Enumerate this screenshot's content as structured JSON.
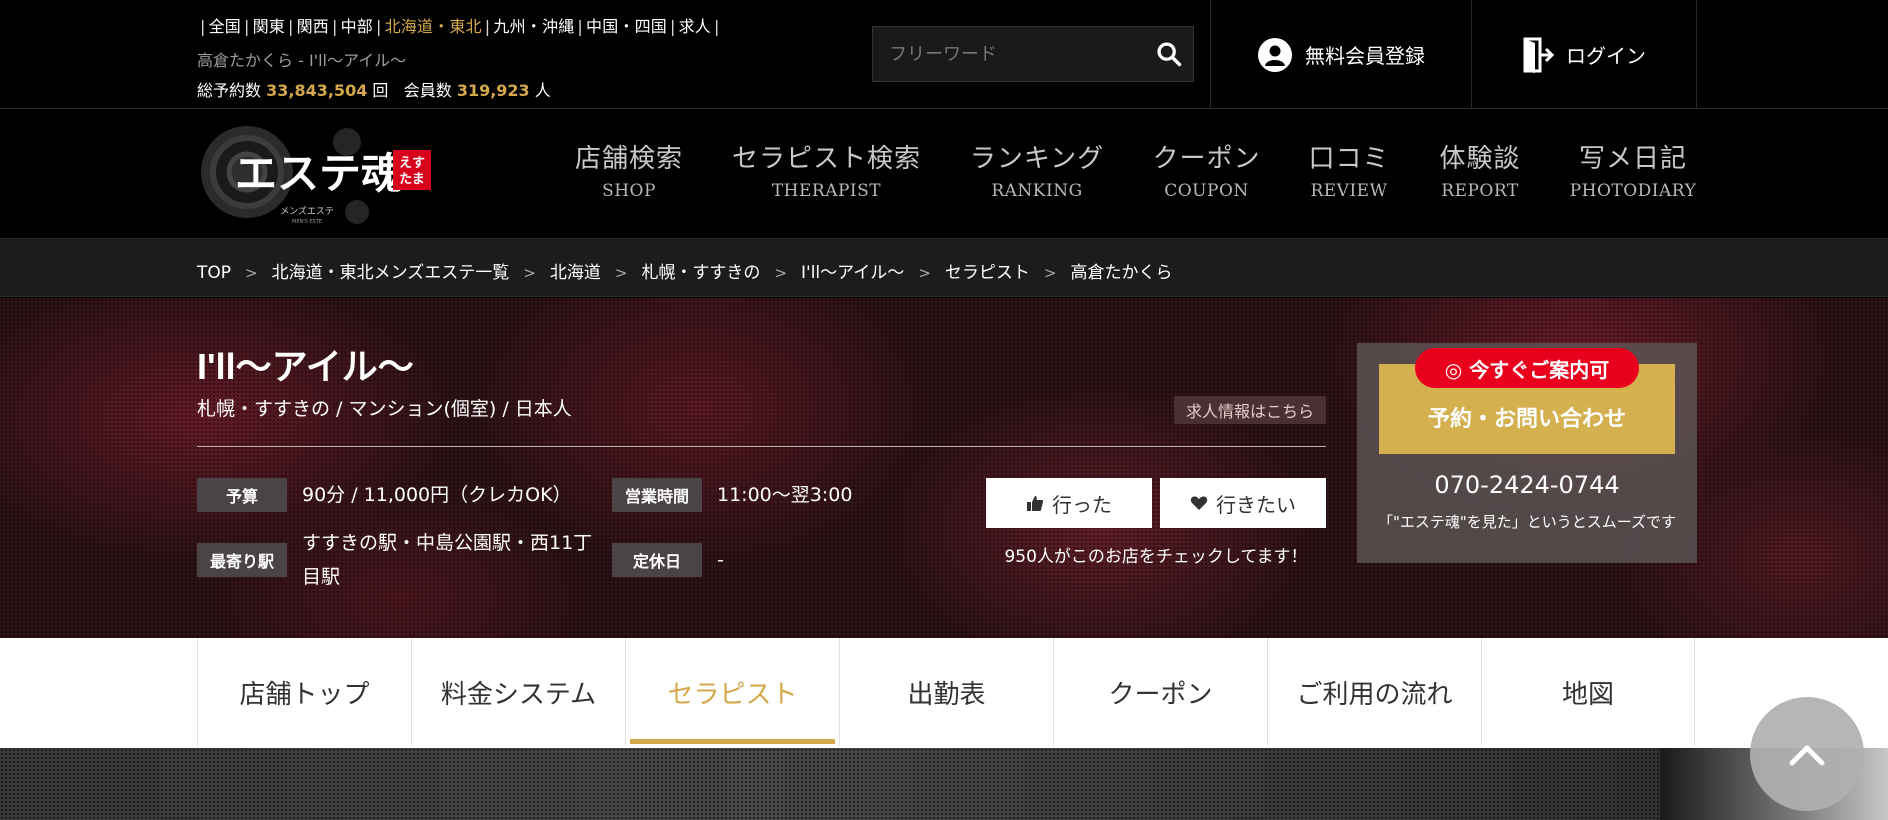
{
  "top": {
    "regions": [
      "全国",
      "関東",
      "関西",
      "中部",
      "北海道・東北",
      "九州・沖縄",
      "中国・四国",
      "求人"
    ],
    "active_region": "北海道・東北",
    "page_subtitle": "高倉たかくら - I'll〜アイル〜",
    "stats": {
      "bookings_label": "総予約数",
      "bookings": "33,843,504",
      "bookings_unit": "回",
      "members_label": "会員数",
      "members": "319,923",
      "members_unit": "人"
    },
    "search_placeholder": "フリーワード",
    "register_label": "無料会員登録",
    "login_label": "ログイン"
  },
  "logo": {
    "text": "エステ魂",
    "badge": "えすたま",
    "tagline": "メンズエステ",
    "tagline_en": "MEN'S ESTE"
  },
  "nav": [
    {
      "jp": "店舗検索",
      "en": "SHOP"
    },
    {
      "jp": "セラピスト検索",
      "en": "THERAPIST"
    },
    {
      "jp": "ランキング",
      "en": "RANKING"
    },
    {
      "jp": "クーポン",
      "en": "COUPON"
    },
    {
      "jp": "口コミ",
      "en": "REVIEW"
    },
    {
      "jp": "体験談",
      "en": "REPORT"
    },
    {
      "jp": "写メ日記",
      "en": "PHOTODIARY"
    }
  ],
  "breadcrumb": [
    "TOP",
    "北海道・東北メンズエステ一覧",
    "北海道",
    "札幌・すすきの",
    "I'll〜アイル〜",
    "セラピスト",
    "高倉たかくら"
  ],
  "shop": {
    "name": "I'll〜アイル〜",
    "subtitle": "札幌・すすきの / マンション(個室) / 日本人",
    "recruit": "求人情報はこちら",
    "budget_label": "予算",
    "budget": "90分 / 11,000円（クレカOK）",
    "hours_label": "営業時間",
    "hours": "11:00〜翌3:00",
    "station_label": "最寄り駅",
    "station": "すすきの駅・中島公園駅・西11丁目駅",
    "holiday_label": "定休日",
    "holiday": "-",
    "went": "行った",
    "want": "行きたい",
    "check_count": "950人がこのお店をチェックしてます！"
  },
  "contact": {
    "badge": "◎ 今すぐご案内可",
    "button": "予約・お問い合わせ",
    "phone": "070-2424-0744",
    "note": "「\"エステ魂\"を見た」というとスムーズです"
  },
  "tabs": [
    "店舗トップ",
    "料金システム",
    "セラピスト",
    "出勤表",
    "クーポン",
    "ご利用の流れ",
    "地図"
  ],
  "active_tab": "セラピスト",
  "colors": {
    "accent": "#d4a84b",
    "badge_red": "#e8001c",
    "contact_gold": "#d4b04f"
  }
}
